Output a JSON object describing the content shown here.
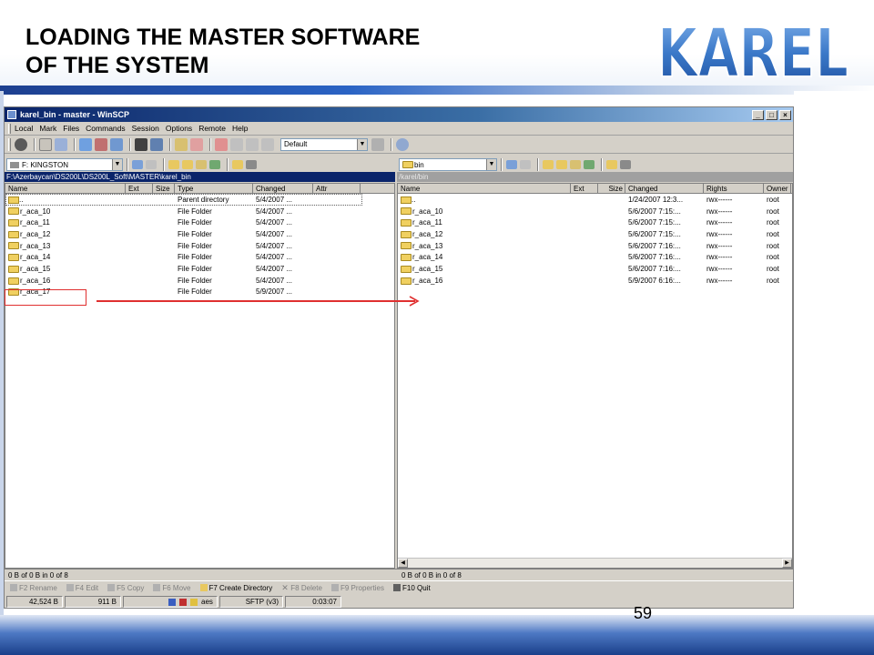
{
  "slide": {
    "title": "LOADING THE MASTER SOFTWARE\nOF THE SYSTEM",
    "logo_text": "KAREL",
    "page_number": "59",
    "colors": {
      "brand_blue": "#1d3f8f",
      "logo_blue": "#3a78c8",
      "highlight_red": "#e03030"
    }
  },
  "window": {
    "title": "karel_bin - master - WinSCP",
    "controls": [
      "_",
      "□",
      "×"
    ],
    "menu": [
      "Local",
      "Mark",
      "Files",
      "Commands",
      "Session",
      "Options",
      "Remote",
      "Help"
    ],
    "toolbar": {
      "session_combo": "Default"
    },
    "left_pane": {
      "drive": "F: KINGSTON",
      "path": "F:\\Azerbaycan\\DS200L\\DS200L_Soft\\MASTER\\karel_bin",
      "columns": [
        "Name",
        "Ext",
        "Size",
        "Type",
        "Changed",
        "Attr"
      ],
      "rows": [
        {
          "name": "..",
          "type": "Parent directory",
          "changed": "5/4/2007 ..."
        },
        {
          "name": "r_aca_10",
          "type": "File Folder",
          "changed": "5/4/2007 ..."
        },
        {
          "name": "r_aca_11",
          "type": "File Folder",
          "changed": "5/4/2007 ..."
        },
        {
          "name": "r_aca_12",
          "type": "File Folder",
          "changed": "5/4/2007 ..."
        },
        {
          "name": "r_aca_13",
          "type": "File Folder",
          "changed": "5/4/2007 ..."
        },
        {
          "name": "r_aca_14",
          "type": "File Folder",
          "changed": "5/4/2007 ..."
        },
        {
          "name": "r_aca_15",
          "type": "File Folder",
          "changed": "5/4/2007 ..."
        },
        {
          "name": "r_aca_16",
          "type": "File Folder",
          "changed": "5/4/2007 ..."
        },
        {
          "name": "r_aca_17",
          "type": "File Folder",
          "changed": "5/9/2007 ..."
        }
      ],
      "status": "0 B of 0 B in 0 of 8"
    },
    "right_pane": {
      "folder": "bin",
      "path": "/karel/bin",
      "columns": [
        "Name",
        "Ext",
        "Size",
        "Changed",
        "Rights",
        "Owner"
      ],
      "rows": [
        {
          "name": "..",
          "changed": "1/24/2007 12:3...",
          "rights": "rwx------",
          "owner": "root"
        },
        {
          "name": "r_aca_10",
          "changed": "5/6/2007 7:15:...",
          "rights": "rwx------",
          "owner": "root"
        },
        {
          "name": "r_aca_11",
          "changed": "5/6/2007 7:15:...",
          "rights": "rwx------",
          "owner": "root"
        },
        {
          "name": "r_aca_12",
          "changed": "5/6/2007 7:15:...",
          "rights": "rwx------",
          "owner": "root"
        },
        {
          "name": "r_aca_13",
          "changed": "5/6/2007 7:16:...",
          "rights": "rwx------",
          "owner": "root"
        },
        {
          "name": "r_aca_14",
          "changed": "5/6/2007 7:16:...",
          "rights": "rwx------",
          "owner": "root"
        },
        {
          "name": "r_aca_15",
          "changed": "5/6/2007 7:16:...",
          "rights": "rwx------",
          "owner": "root"
        },
        {
          "name": "r_aca_16",
          "changed": "5/9/2007 6:16:...",
          "rights": "rwx------",
          "owner": "root"
        }
      ],
      "status": "0 B of 0 B in 0 of 8"
    },
    "function_keys": [
      "F2 Rename",
      "F4 Edit",
      "F5 Copy",
      "F6 Move",
      "F7 Create Directory",
      "F8 Delete",
      "F9 Properties",
      "F10 Quit"
    ],
    "statusbar": [
      "42,524 B",
      "911 B",
      "aes",
      "SFTP (v3)",
      "0:03:07"
    ]
  }
}
